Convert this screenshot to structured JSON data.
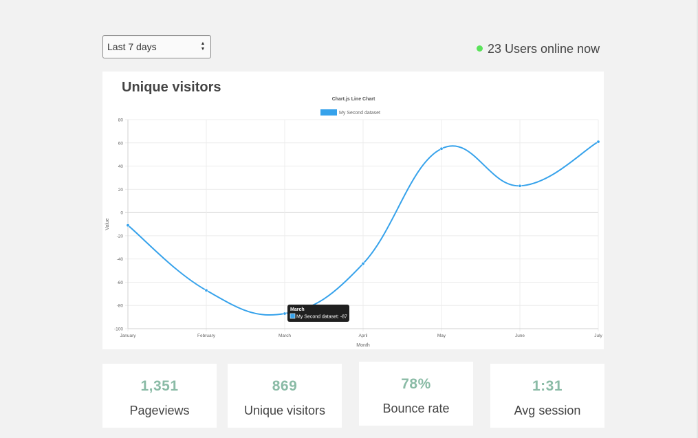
{
  "date_range": {
    "selected": "Last 7 days",
    "arrow_up": "▲",
    "arrow_down": "▼"
  },
  "online": {
    "text": "23 Users online now",
    "dot_color": "#5be35b"
  },
  "chart_card": {
    "heading": "Unique visitors"
  },
  "chart_data": {
    "type": "line",
    "title": "Chart.js Line Chart",
    "xlabel": "Month",
    "ylabel": "Value",
    "categories": [
      "January",
      "February",
      "March",
      "April",
      "May",
      "June",
      "July"
    ],
    "series": [
      {
        "name": "My Second dataset",
        "color": "#36a2eb",
        "values": [
          -11,
          -67,
          -87,
          -44,
          55,
          23,
          61
        ]
      }
    ],
    "ylim": [
      -100,
      80
    ],
    "yticks": [
      80,
      60,
      40,
      20,
      0,
      -20,
      -40,
      -60,
      -80,
      -100
    ],
    "grid": true,
    "legend_position": "top",
    "tooltip": {
      "title": "March",
      "text": "My Second dataset: -87",
      "category": "March"
    }
  },
  "stats": [
    {
      "value": "1,351",
      "label": "Pageviews"
    },
    {
      "value": "869",
      "label": "Unique visitors"
    },
    {
      "value": "78%",
      "label": "Bounce rate"
    },
    {
      "value": "1:31",
      "label": "Avg session"
    }
  ]
}
